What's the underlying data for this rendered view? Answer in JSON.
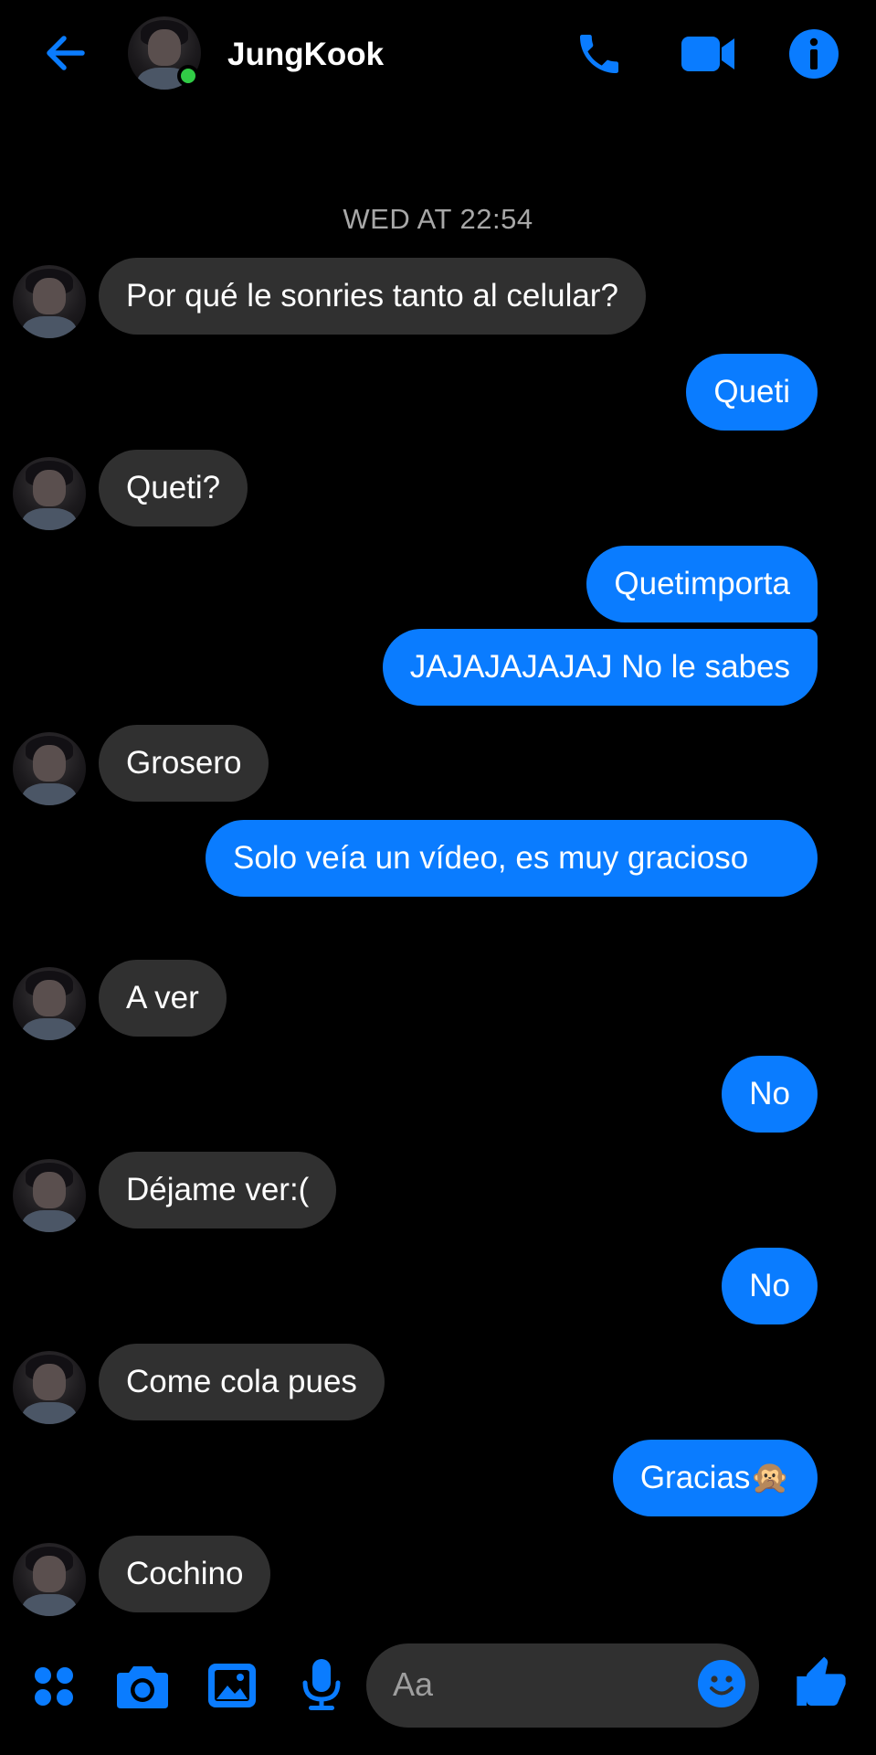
{
  "header": {
    "contact_name": "JungKook",
    "online": true,
    "icons": [
      "back-arrow-icon",
      "phone-icon",
      "video-camera-icon",
      "info-icon"
    ]
  },
  "thread": {
    "timestamp": "WED AT 22:54",
    "messages": [
      {
        "from": "contact",
        "text": "Por qué le sonries tanto al celular?"
      },
      {
        "from": "me",
        "text": "Queti"
      },
      {
        "from": "contact",
        "text": "Queti?"
      },
      {
        "from": "me",
        "text": "Quetimporta"
      },
      {
        "from": "me",
        "text": "JAJAJAJAJAJ No le sabes"
      },
      {
        "from": "contact",
        "text": "Grosero"
      },
      {
        "from": "me",
        "text": "Solo veía un vídeo, es muy gracioso"
      },
      {
        "from": "contact",
        "text": "A ver"
      },
      {
        "from": "me",
        "text": "No"
      },
      {
        "from": "contact",
        "text": "Déjame ver:("
      },
      {
        "from": "me",
        "text": "No"
      },
      {
        "from": "contact",
        "text": "Come cola pues"
      },
      {
        "from": "me",
        "text": "Gracias🙊"
      },
      {
        "from": "contact",
        "text": "Cochino"
      }
    ]
  },
  "composer": {
    "placeholder": "Aa",
    "icons": [
      "apps-grid-icon",
      "camera-icon",
      "gallery-icon",
      "microphone-icon",
      "emoji-icon",
      "thumbs-up-icon"
    ]
  },
  "colors": {
    "accent": "#0a7cff",
    "incoming_bubble": "#303030",
    "background": "#000000",
    "online_dot": "#31cc46"
  }
}
